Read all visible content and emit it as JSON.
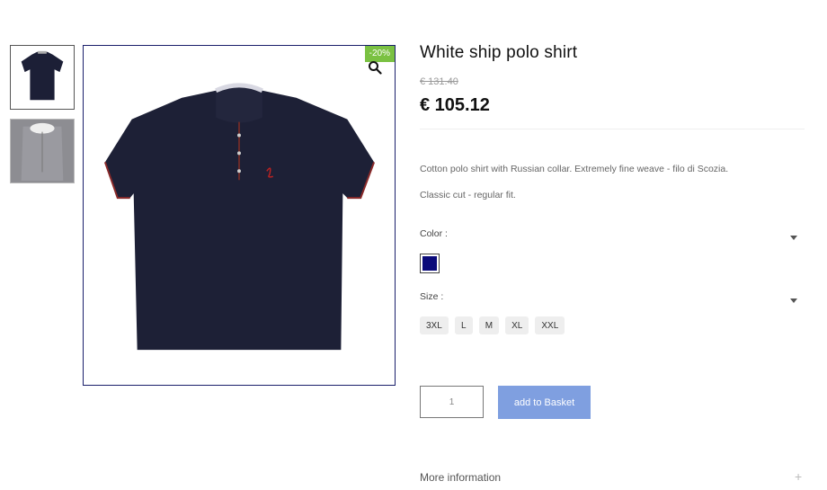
{
  "product": {
    "title": "White ship polo shirt",
    "old_price": "€ 131.40",
    "price": "€ 105.12",
    "sale_badge": "-20%",
    "description": [
      "Cotton polo shirt with Russian collar. Extremely fine weave - filo di Scozia.",
      "Classic cut - regular fit."
    ]
  },
  "gallery": {
    "thumbnails": [
      "navy-front",
      "white-back"
    ],
    "main_image": "navy-polo-shirt"
  },
  "attributes": {
    "color_label": "Color :",
    "color_swatch": "#0a0a7a",
    "size_label": "Size :",
    "sizes": [
      "3XL",
      "L",
      "M",
      "XL",
      "XXL"
    ]
  },
  "cart": {
    "quantity": "1",
    "add_label": "add to Basket"
  },
  "more_info_label": "More information",
  "more_info_icon": "+",
  "icons": {
    "zoom": "magnifier-icon",
    "dropdown": "caret-down-icon"
  }
}
